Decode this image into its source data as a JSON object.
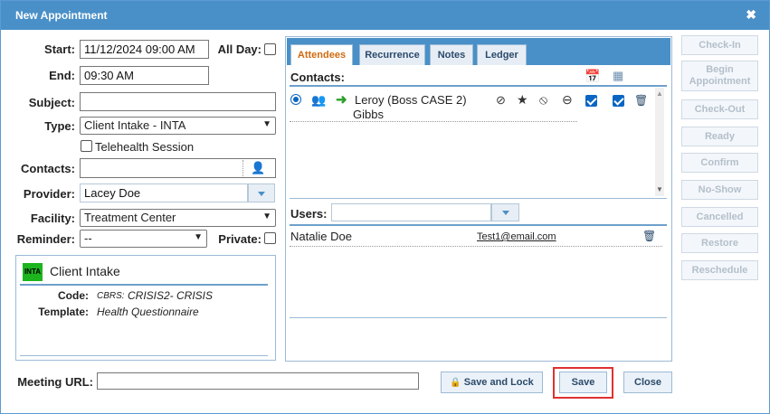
{
  "dialog": {
    "title": "New Appointment"
  },
  "form": {
    "start_label": "Start:",
    "start_value": "11/12/2024 09:00 AM",
    "allday_label": "All Day:",
    "end_label": "End:",
    "end_value": "09:30 AM",
    "subject_label": "Subject:",
    "subject_value": "",
    "type_label": "Type:",
    "type_value": "Client Intake - INTA",
    "telehealth_label": "Telehealth Session",
    "contacts_label": "Contacts:",
    "contacts_value": "",
    "provider_label": "Provider:",
    "provider_value": "Lacey Doe",
    "facility_label": "Facility:",
    "facility_value": "Treatment Center",
    "reminder_label": "Reminder:",
    "reminder_value": "--",
    "private_label": "Private:",
    "meeting_url_label": "Meeting URL:",
    "meeting_url_value": ""
  },
  "appt_type": {
    "tag": "INTA",
    "name": "Client Intake",
    "code_label": "Code:",
    "code_prefix": "CBRS:",
    "code_value": "CRISIS2- CRISIS",
    "template_label": "Template:",
    "template_value": "Health Questionnaire"
  },
  "tabs": [
    "Attendees",
    "Recurrence",
    "Notes",
    "Ledger"
  ],
  "attendees": {
    "contacts_label": "Contacts:",
    "contact_line1": "Leroy (Boss CASE 2)",
    "contact_line2": "Gibbs",
    "users_label": "Users:",
    "users_value": "",
    "user_name": "Natalie Doe",
    "user_email": "Test1@email.com"
  },
  "side_buttons": [
    "Check-In",
    "Begin Appointment",
    "Check-Out",
    "Ready",
    "Confirm",
    "No-Show",
    "Cancelled",
    "Restore",
    "Reschedule"
  ],
  "footer": {
    "save_lock": "Save and Lock",
    "save": "Save",
    "close": "Close"
  },
  "colors": {
    "titlebar": "#4a90c8",
    "active_tab_text": "#d06a10",
    "highlight_border": "#e03030",
    "inta_tag": "#1db41d"
  }
}
